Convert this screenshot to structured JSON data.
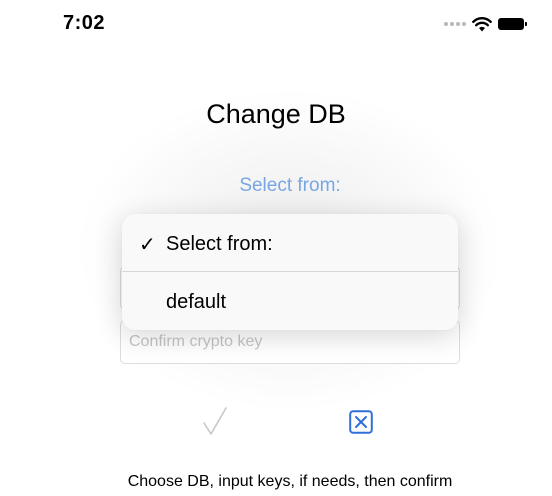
{
  "status_bar": {
    "time": "7:02",
    "icons": [
      "signal-dots-icon",
      "wifi-icon",
      "battery-icon"
    ]
  },
  "dialog": {
    "title": "Change DB",
    "select_link": "Select from:",
    "fields": {
      "key_field_placeholder": "",
      "confirm_key_placeholder": "Confirm crypto key"
    },
    "menu": {
      "items": [
        {
          "label": "Select from:",
          "selected": true
        },
        {
          "label": "default",
          "selected": false
        }
      ],
      "check_mark": "✓"
    },
    "actions": {
      "confirm_icon": "checkmark-icon",
      "cancel_icon": "close-square-icon"
    },
    "hint": "Choose DB, input keys, if needs, then confirm"
  },
  "colors": {
    "accent": "#78a6e4",
    "cancel": "#2f6fd6",
    "confirm_disabled": "#c8c8c8",
    "placeholder": "#c4c4c4"
  }
}
